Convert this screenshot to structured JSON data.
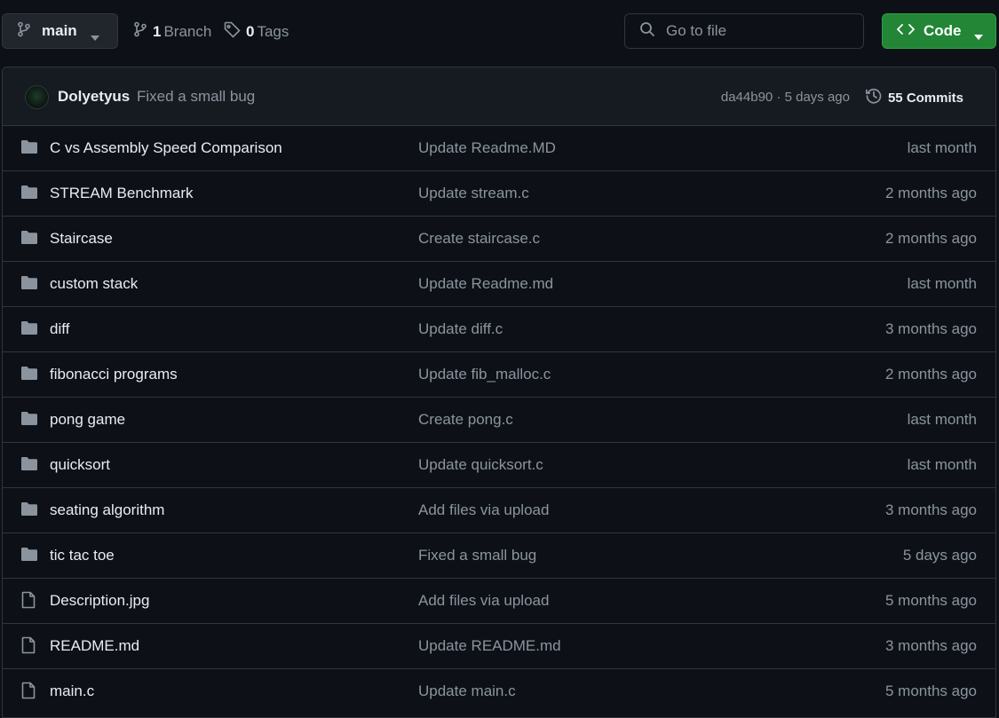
{
  "toolbar": {
    "branch_name": "main",
    "branch_count": "1",
    "branch_label": "Branch",
    "tag_count": "0",
    "tag_label": "Tags",
    "search_placeholder": "Go to file",
    "code_label": "Code",
    "code_button_color": "#238636"
  },
  "latest_commit": {
    "author": "Dolyetyus",
    "message": "Fixed a small bug",
    "hash_age": "da44b90 · 5 days ago",
    "commits_count": "55",
    "commits_label": "Commits"
  },
  "files": [
    {
      "type": "folder",
      "name": "C vs Assembly Speed Comparison",
      "message": "Update Readme.MD",
      "age": "last month"
    },
    {
      "type": "folder",
      "name": "STREAM Benchmark",
      "message": "Update stream.c",
      "age": "2 months ago"
    },
    {
      "type": "folder",
      "name": "Staircase",
      "message": "Create staircase.c",
      "age": "2 months ago"
    },
    {
      "type": "folder",
      "name": "custom stack",
      "message": "Update Readme.md",
      "age": "last month"
    },
    {
      "type": "folder",
      "name": "diff",
      "message": "Update diff.c",
      "age": "3 months ago"
    },
    {
      "type": "folder",
      "name": "fibonacci programs",
      "message": "Update fib_malloc.c",
      "age": "2 months ago"
    },
    {
      "type": "folder",
      "name": "pong game",
      "message": "Create pong.c",
      "age": "last month"
    },
    {
      "type": "folder",
      "name": "quicksort",
      "message": "Update quicksort.c",
      "age": "last month"
    },
    {
      "type": "folder",
      "name": "seating algorithm",
      "message": "Add files via upload",
      "age": "3 months ago"
    },
    {
      "type": "folder",
      "name": "tic tac toe",
      "message": "Fixed a small bug",
      "age": "5 days ago"
    },
    {
      "type": "file",
      "name": "Description.jpg",
      "message": "Add files via upload",
      "age": "5 months ago"
    },
    {
      "type": "file",
      "name": "README.md",
      "message": "Update README.md",
      "age": "3 months ago"
    },
    {
      "type": "file",
      "name": "main.c",
      "message": "Update main.c",
      "age": "5 months ago"
    }
  ]
}
